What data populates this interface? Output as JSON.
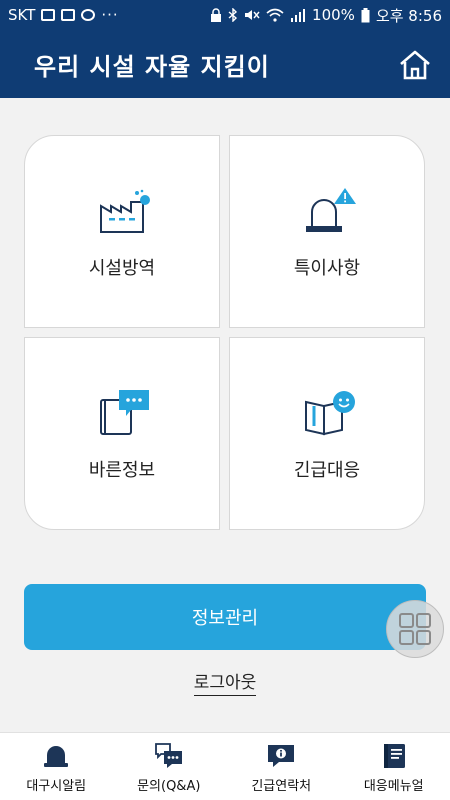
{
  "status_bar": {
    "carrier": "SKT",
    "battery": "100%",
    "time": "오후 8:56",
    "dots": "···"
  },
  "header": {
    "title": "우리 시설 자율 지킴이"
  },
  "cards": [
    {
      "label": "시설방역",
      "icon": "factory-icon"
    },
    {
      "label": "특이사항",
      "icon": "siren-alert-icon"
    },
    {
      "label": "바른정보",
      "icon": "book-chat-icon"
    },
    {
      "label": "긴급대응",
      "icon": "book-smile-icon"
    }
  ],
  "main_button": {
    "label": "정보관리"
  },
  "logout": {
    "label": "로그아웃"
  },
  "bottom_nav": [
    {
      "label": "대구시알림",
      "icon": "bell-icon"
    },
    {
      "label": "문의(Q&A)",
      "icon": "chat-bubbles-icon"
    },
    {
      "label": "긴급연락처",
      "icon": "info-bubble-icon"
    },
    {
      "label": "대응메뉴얼",
      "icon": "manual-book-icon"
    }
  ],
  "colors": {
    "header_bg": "#0f3c74",
    "accent": "#26a4dc",
    "icon_navy": "#1d3557"
  }
}
